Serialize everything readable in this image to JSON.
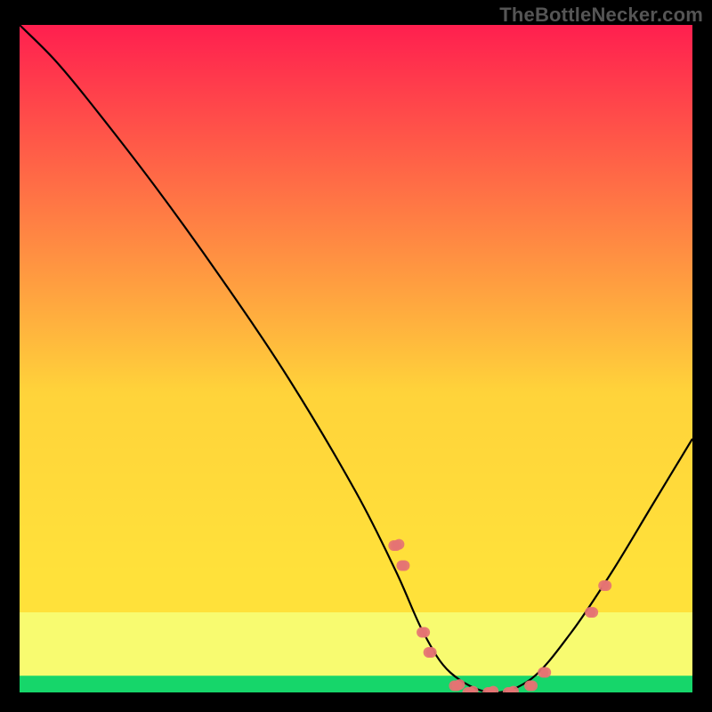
{
  "watermark": "TheBottleNecker.com",
  "chart_data": {
    "type": "line",
    "title": "",
    "xlabel": "",
    "ylabel": "",
    "xlim": [
      0,
      100
    ],
    "ylim": [
      0,
      100
    ],
    "background_gradient": {
      "top": "#ff1f4f",
      "mid": "#ffe13a",
      "bottom_band": "#f7ff7a",
      "footer_band": "#16d66a"
    },
    "curve": [
      {
        "x": 0,
        "y": 100
      },
      {
        "x": 5,
        "y": 95
      },
      {
        "x": 10,
        "y": 89
      },
      {
        "x": 20,
        "y": 76
      },
      {
        "x": 30,
        "y": 62
      },
      {
        "x": 40,
        "y": 47
      },
      {
        "x": 50,
        "y": 30
      },
      {
        "x": 56,
        "y": 18
      },
      {
        "x": 60,
        "y": 9
      },
      {
        "x": 64,
        "y": 3
      },
      {
        "x": 70,
        "y": 0
      },
      {
        "x": 76,
        "y": 2
      },
      {
        "x": 82,
        "y": 9
      },
      {
        "x": 88,
        "y": 18
      },
      {
        "x": 94,
        "y": 28
      },
      {
        "x": 100,
        "y": 38
      }
    ],
    "marker_clusters": [
      {
        "cx": 56,
        "cy": 22,
        "n": 3
      },
      {
        "cx": 57,
        "cy": 19,
        "n": 2
      },
      {
        "cx": 60,
        "cy": 9,
        "n": 2
      },
      {
        "cx": 61,
        "cy": 6,
        "n": 2
      },
      {
        "cx": 65,
        "cy": 1,
        "n": 3
      },
      {
        "cx": 67,
        "cy": 0,
        "n": 3
      },
      {
        "cx": 70,
        "cy": 0,
        "n": 3
      },
      {
        "cx": 73,
        "cy": 0,
        "n": 3
      },
      {
        "cx": 76,
        "cy": 1,
        "n": 2
      },
      {
        "cx": 78,
        "cy": 3,
        "n": 2
      },
      {
        "cx": 85,
        "cy": 12,
        "n": 2
      },
      {
        "cx": 87,
        "cy": 16,
        "n": 2
      }
    ],
    "marker_color": "#e57373",
    "marker_radius_px": 6
  }
}
